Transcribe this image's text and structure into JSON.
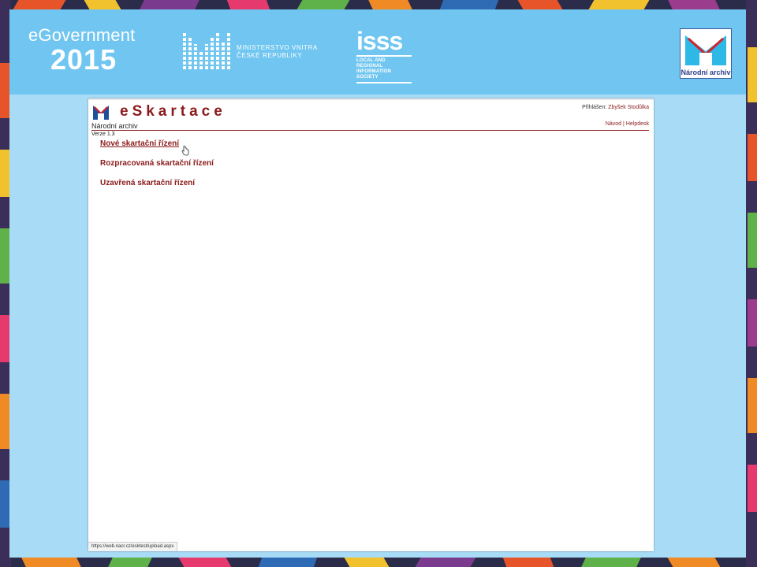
{
  "banner": {
    "egov_line1": "eGovernment",
    "egov_year": "2015",
    "ministry_line1": "MINISTERSTVO VNITRA",
    "ministry_line2": "ČESKÉ REPUBLIKY",
    "isss_mark": "isss",
    "isss_line1": "LOCAL AND REGIONAL",
    "isss_line2": "INFORMATION SOCIETY",
    "archive_caption": "Národní archiv"
  },
  "app": {
    "title": "eSkartace",
    "subtitle": "Národní archiv",
    "version": "Verze 1.3",
    "login_label": "Přihlášen:",
    "login_user": "Zbyšek Stodůlka",
    "help_link_1": "Návod",
    "help_separator": "|",
    "help_link_2": "Helpdesk"
  },
  "menu": {
    "items": [
      {
        "label": "Nové skartační řízení"
      },
      {
        "label": "Rozpracovaná skartační řízení"
      },
      {
        "label": "Uzavřená skartační řízení"
      }
    ]
  },
  "statusbar": {
    "url": "https://web.nacr.cz/esktest/upload.aspx"
  },
  "colors": {
    "brand_dark_red": "#8b1a1a",
    "banner_blue": "#70c6f0",
    "frame_blue": "#a8dcf6"
  }
}
